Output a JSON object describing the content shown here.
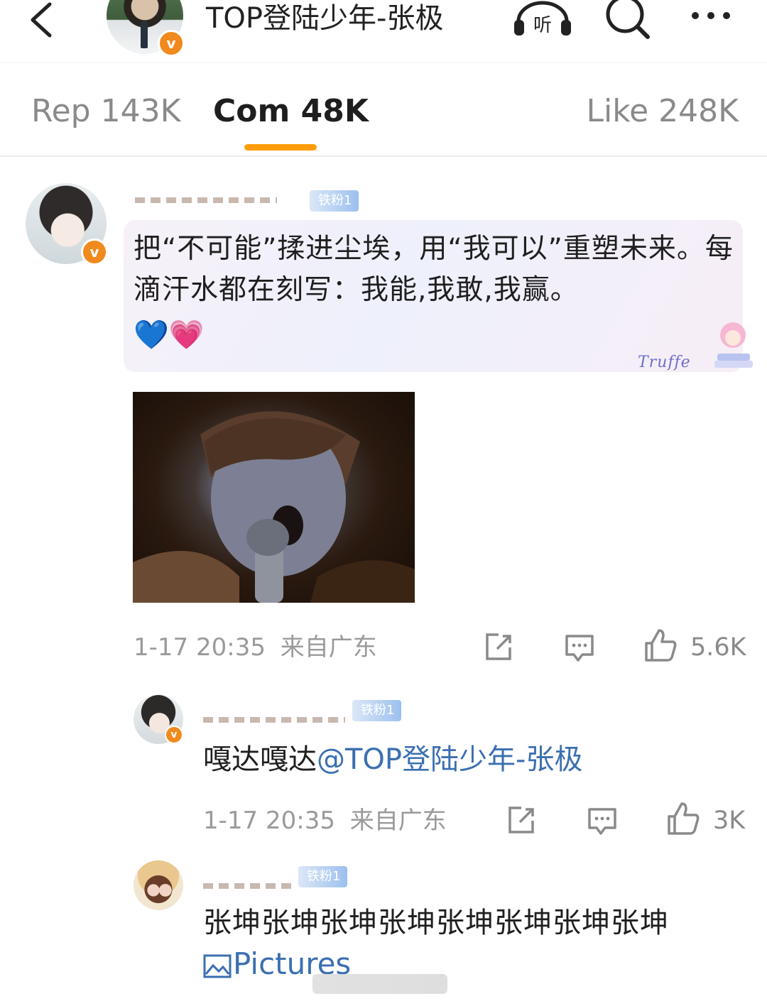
{
  "header": {
    "title": "TOP登陆少年-张极",
    "listen_label": "听",
    "colors": {
      "verified": "#f08a1c",
      "accent_tab": "#ff9d0a",
      "link": "#3b6fb1",
      "fan_badge": "#9cc0ef"
    }
  },
  "tabs": [
    {
      "label": "Rep 143K",
      "active": false
    },
    {
      "label": "Com 48K",
      "active": true
    },
    {
      "label": "Like 248K",
      "active": false
    }
  ],
  "comments": [
    {
      "fan_badge": "铁粉1",
      "text": "把“不可能”揉进尘埃，用“我可以”重塑未来。每滴汗水都在刻写：我能,我敢,我赢。",
      "emoji": [
        "💙",
        "💗"
      ],
      "bubble_signature": "Truffe",
      "time": "1-17 20:35",
      "location": "来自广东",
      "likes": "5.6K",
      "replies": [
        {
          "fan_badge": "铁粉1",
          "text": "嘎达嘎达",
          "mention": "@TOP登陆少年-张极",
          "time": "1-17 20:35",
          "location": "来自广东",
          "likes": "3K"
        },
        {
          "fan_badge": "铁粉1",
          "text": "张坤张坤张坤张坤张坤张坤张坤张坤",
          "attachment_label": "Pictures"
        }
      ]
    }
  ],
  "icons": [
    "back-arrow-icon",
    "listen-headphones-icon",
    "search-icon",
    "more-dots-icon",
    "share-icon",
    "comment-icon",
    "like-thumb-icon",
    "picture-icon",
    "verified-badge-icon"
  ]
}
